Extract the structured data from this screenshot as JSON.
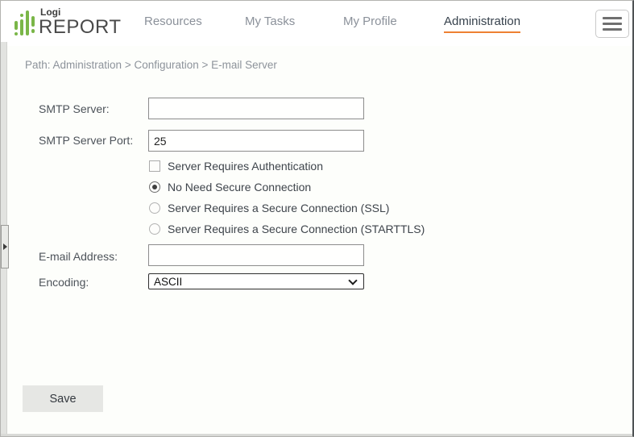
{
  "header": {
    "logo": {
      "top": "Logi",
      "bottom": "REPORT"
    },
    "nav": [
      {
        "label": "Resources",
        "active": false
      },
      {
        "label": "My Tasks",
        "active": false
      },
      {
        "label": "My Profile",
        "active": false
      },
      {
        "label": "Administration",
        "active": true
      }
    ]
  },
  "breadcrumb": "Path: Administration > Configuration > E-mail Server",
  "form": {
    "smtp_server": {
      "label": "SMTP Server:",
      "value": ""
    },
    "smtp_port": {
      "label": "SMTP Server Port:",
      "value": "25"
    },
    "auth_checkbox": {
      "label": "Server Requires Authentication",
      "checked": false
    },
    "secure_options": [
      {
        "label": "No Need Secure Connection",
        "selected": true
      },
      {
        "label": "Server Requires a Secure Connection (SSL)",
        "selected": false
      },
      {
        "label": "Server Requires a Secure Connection (STARTTLS)",
        "selected": false
      }
    ],
    "email_address": {
      "label": "E-mail Address:",
      "value": ""
    },
    "encoding": {
      "label": "Encoding:",
      "value": "ASCII"
    }
  },
  "save_button": "Save",
  "colors": {
    "accent_orange": "#ee8133",
    "logo_green": "#7ab648",
    "nav_gray": "#8b919a",
    "active_nav": "#37424d",
    "background": "#fdfefb"
  }
}
